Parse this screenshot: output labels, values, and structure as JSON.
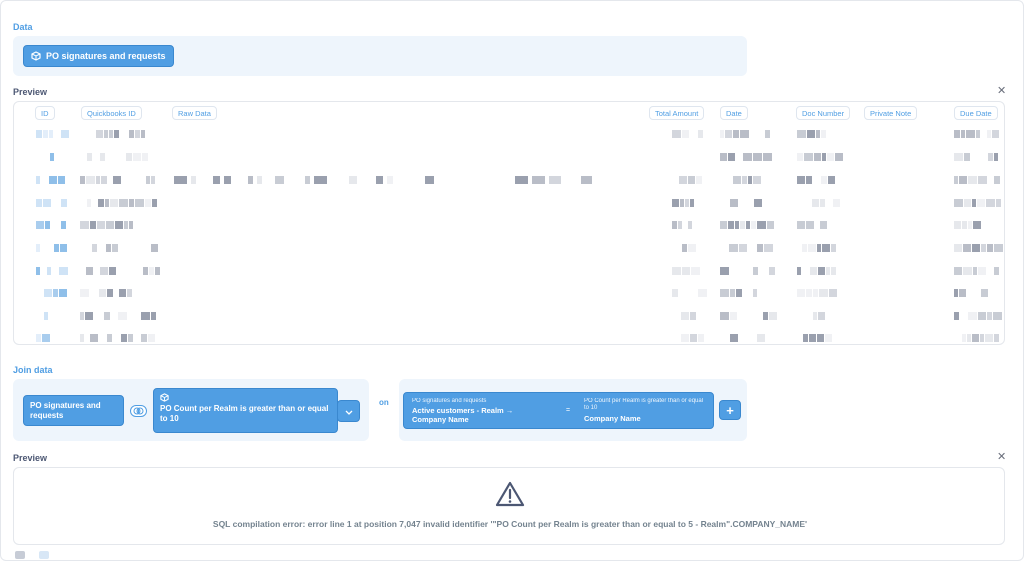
{
  "data_section": {
    "title": "Data",
    "source_button": "PO signatures and requests"
  },
  "preview_section": {
    "title": "Preview",
    "columns": [
      "ID",
      "Quickbooks ID",
      "Raw Data",
      "Total Amount",
      "Date",
      "Doc Number",
      "Private Note",
      "Due Date"
    ]
  },
  "join_section": {
    "title": "Join data",
    "left_table": "PO signatures and requests",
    "right_table": "PO Count per Realm is greater than or equal to 10",
    "on_label": "on",
    "condition": {
      "left_source": "PO signatures and requests",
      "left_field": "Active customers - Realm → Company Name",
      "operator": "=",
      "right_source": "PO Count per Realm is greater than or equal to 10",
      "right_field": "Company Name"
    },
    "add_label": "+"
  },
  "preview2_section": {
    "title": "Preview",
    "error_message": "SQL compilation error: error line 1 at position 7,047 invalid identifier '\"PO Count per Realm is greater than or equal to 5 - Realm\".COMPANY_NAME'"
  },
  "icons": {
    "close": "close-icon",
    "table": "table-icon",
    "join": "join-type-icon",
    "chevron": "chevron-down-icon",
    "warning": "warning-icon"
  },
  "colors": {
    "accent": "#509ee3",
    "panel": "#eef5fc",
    "text": "#4c5773"
  }
}
